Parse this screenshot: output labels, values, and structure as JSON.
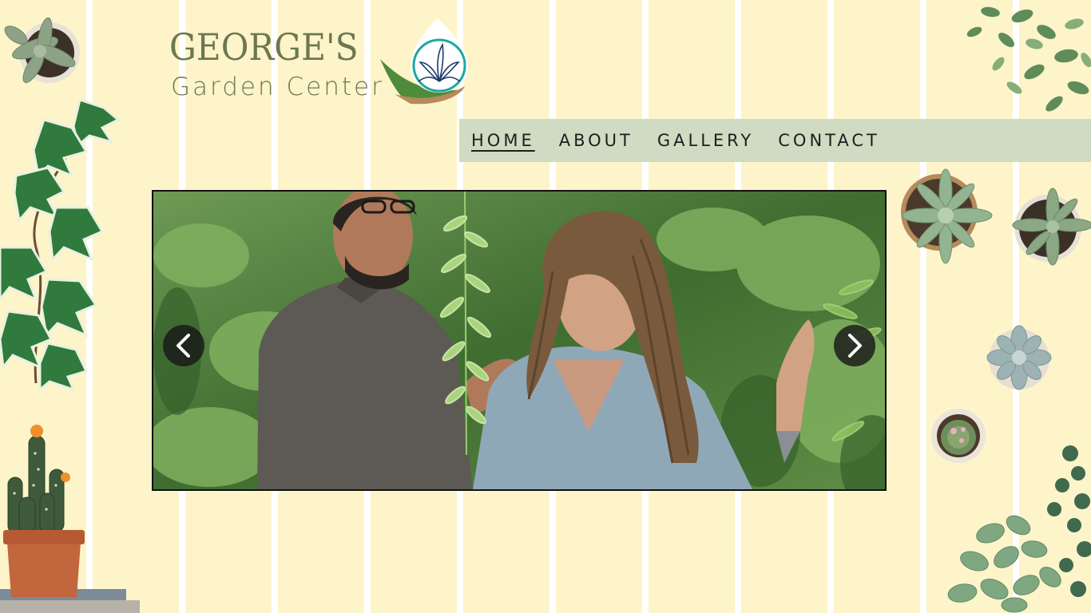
{
  "brand": {
    "title": "GEORGE'S",
    "subtitle": "Garden Center",
    "logo_icon": "leaf-drop-logo-icon"
  },
  "nav": {
    "items": [
      {
        "label": "HOME",
        "active": true
      },
      {
        "label": "ABOUT",
        "active": false
      },
      {
        "label": "GALLERY",
        "active": false
      },
      {
        "label": "CONTACT",
        "active": false
      }
    ]
  },
  "slider": {
    "prev_icon": "chevron-left-icon",
    "next_icon": "chevron-right-icon"
  },
  "colors": {
    "background": "#fdf4c9",
    "stripe": "#ffffff",
    "brand_green": "#6b7752",
    "nav_bg": "#cfdbc2",
    "logo_teal": "#1ea7a0",
    "logo_navy": "#1f3a6b"
  }
}
